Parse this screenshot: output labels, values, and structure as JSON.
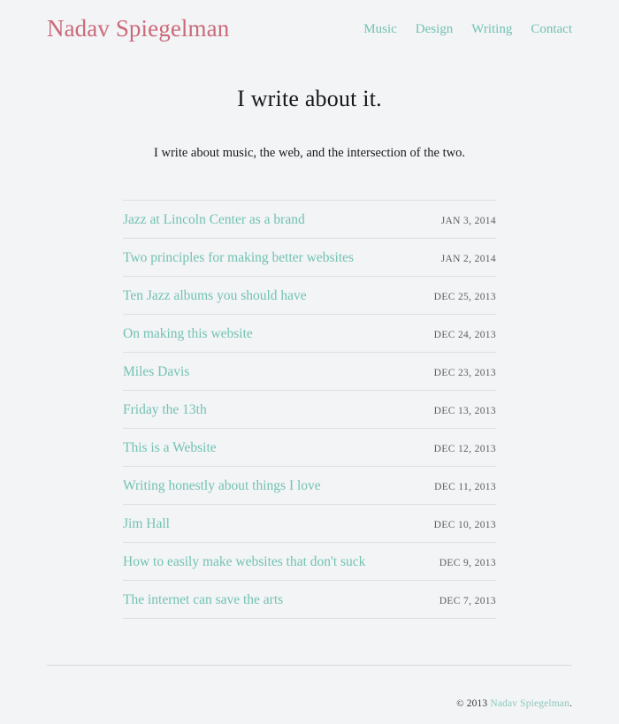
{
  "site": {
    "logo": "Nadav Spiegelman",
    "logo_color": "#ca6a79",
    "accent_color": "#72c2b3",
    "background_color": "#f3f4f6",
    "rule_color": "#dcdee1"
  },
  "nav": {
    "items": [
      {
        "label": "Music"
      },
      {
        "label": "Design"
      },
      {
        "label": "Writing"
      },
      {
        "label": "Contact"
      }
    ]
  },
  "intro": {
    "title": "I write about it.",
    "subtitle": "I write about music, the web, and the intersection of the two."
  },
  "posts": [
    {
      "title": "Jazz at Lincoln Center as a brand",
      "date": "Jan 3, 2014"
    },
    {
      "title": "Two principles for making better websites",
      "date": "Jan 2, 2014"
    },
    {
      "title": "Ten Jazz albums you should have",
      "date": "Dec 25, 2013"
    },
    {
      "title": "On making this website",
      "date": "Dec 24, 2013"
    },
    {
      "title": "Miles Davis",
      "date": "Dec 23, 2013"
    },
    {
      "title": "Friday the 13th",
      "date": "Dec 13, 2013"
    },
    {
      "title": "This is a Website",
      "date": "Dec 12, 2013"
    },
    {
      "title": "Writing honestly about things I love",
      "date": "Dec 11, 2013"
    },
    {
      "title": "Jim Hall",
      "date": "Dec 10, 2013"
    },
    {
      "title": "How to easily make websites that don't suck",
      "date": "Dec 9, 2013"
    },
    {
      "title": "The internet can save the arts",
      "date": "Dec 7, 2013"
    }
  ],
  "footer": {
    "symbol": "©",
    "year": "2013",
    "link_label": "Nadav Spiegelman",
    "suffix": "."
  }
}
